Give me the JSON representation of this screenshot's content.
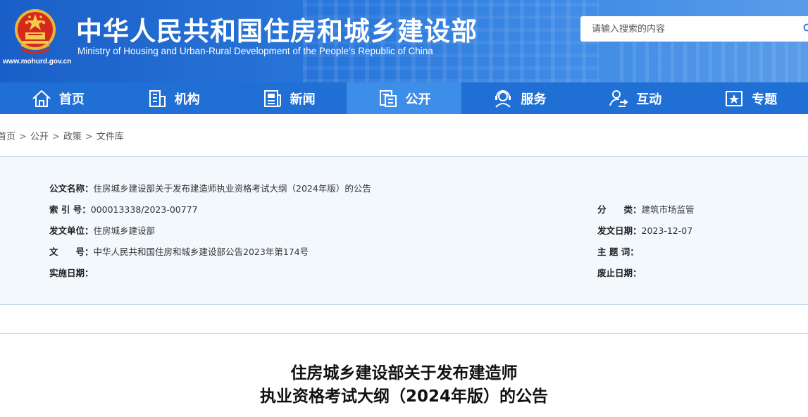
{
  "header": {
    "title": "中华人民共和国住房和城乡建设部",
    "subtitle": "Ministry of Housing and Urban-Rural Development of the People’s Republic of China",
    "url": "www.mohurd.gov.cn"
  },
  "search": {
    "placeholder": "请输入搜索的内容"
  },
  "nav": {
    "items": [
      {
        "label": "首页",
        "icon": "home-icon"
      },
      {
        "label": "机构",
        "icon": "building-icon"
      },
      {
        "label": "新闻",
        "icon": "newspaper-icon"
      },
      {
        "label": "公开",
        "icon": "document-icon"
      },
      {
        "label": "服务",
        "icon": "service-icon"
      },
      {
        "label": "互动",
        "icon": "interaction-icon"
      },
      {
        "label": "专题",
        "icon": "topic-icon"
      }
    ],
    "active": "公开"
  },
  "breadcrumb": [
    "首页",
    "公开",
    "政策",
    "文件库"
  ],
  "breadcrumb_separator": ">",
  "info": {
    "title_label": "公文名称：",
    "title_value": "住房城乡建设部关于发布建造师执业资格考试大纲（2024年版）的公告",
    "index_label": "索 引 号：",
    "index_value": "000013338/2023-00777",
    "category_label": "分　　类：",
    "category_value": "建筑市场监管",
    "issuer_label": "发文单位：",
    "issuer_value": "住房城乡建设部",
    "date_label": "发文日期：",
    "date_value": "2023-12-07",
    "docno_label": "文　　号：",
    "docno_value": "中华人民共和国住房和城乡建设部公告2023年第174号",
    "subject_label": "主 题 词：",
    "subject_value": "",
    "effective_label": "实施日期：",
    "effective_value": "",
    "expiry_label": "废止日期：",
    "expiry_value": ""
  },
  "document": {
    "title_line1": "住房城乡建设部关于发布建造师",
    "title_line2": "执业资格考试大纲（2024年版）的公告"
  },
  "colors": {
    "header_blue": "#1a5fc7",
    "nav_blue": "#1f6fd4",
    "nav_active": "#3d8ee8",
    "panel_bg": "#f3f8fd"
  }
}
